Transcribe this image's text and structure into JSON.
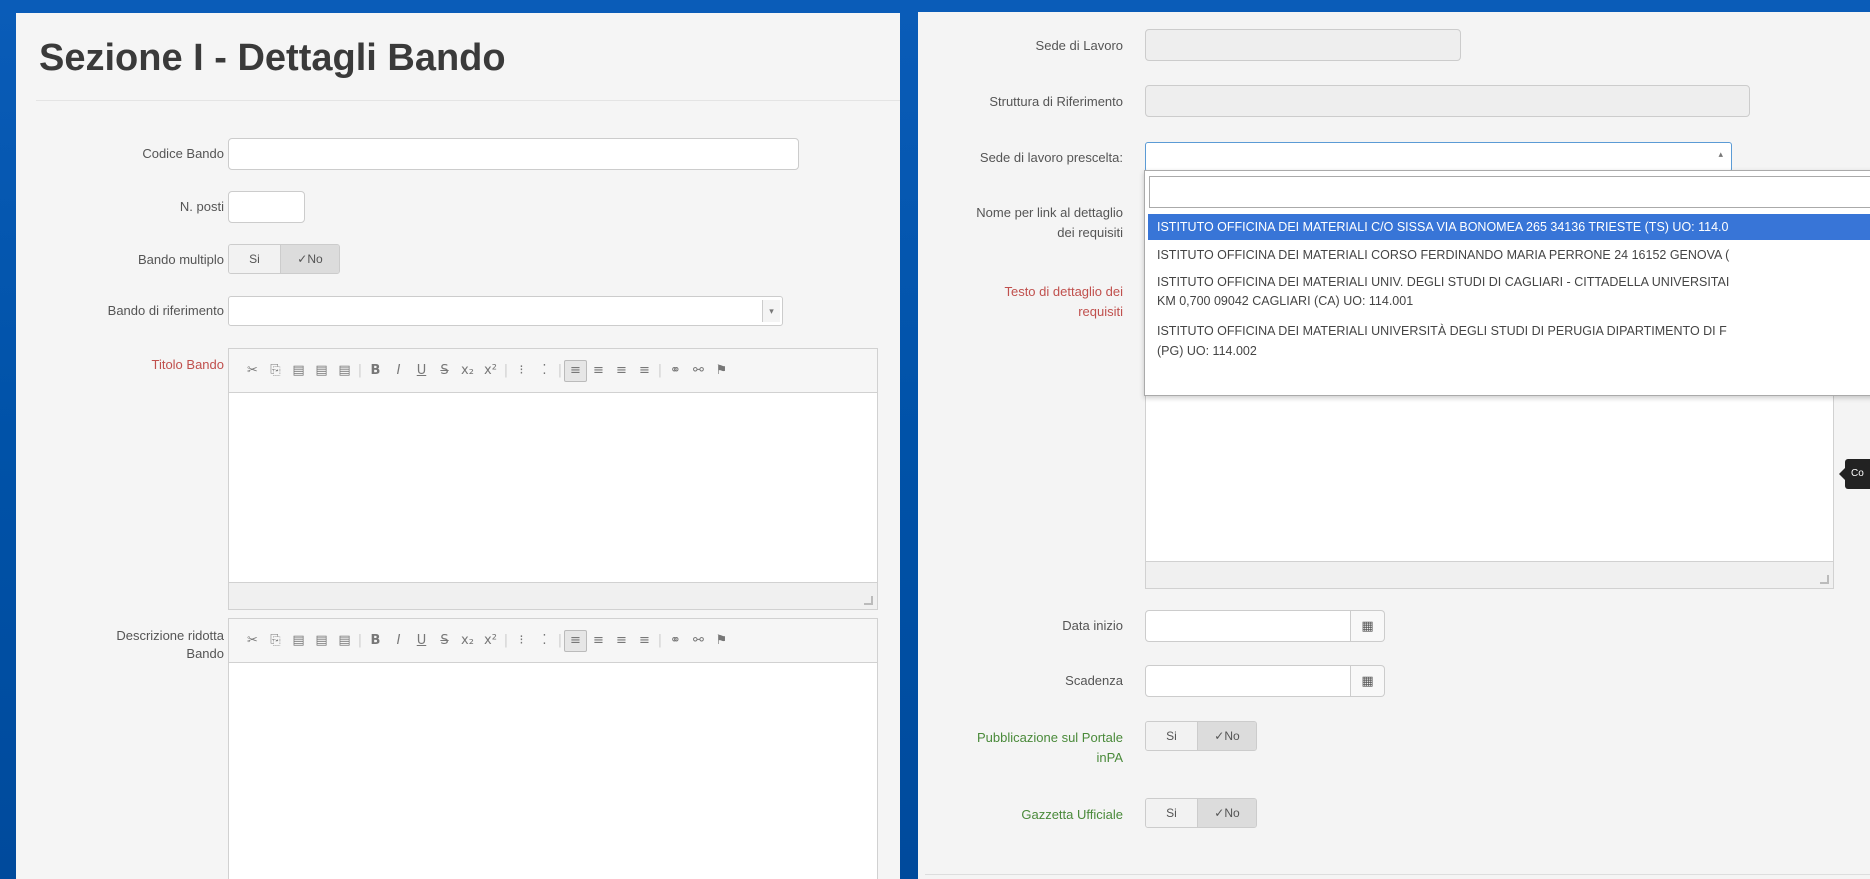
{
  "left": {
    "title": "Sezione I - Dettagli Bando",
    "fields": {
      "codice_bando": "Codice Bando",
      "n_posti": "N. posti",
      "bando_multiplo": "Bando multiplo",
      "bando_riferimento": "Bando di riferimento",
      "titolo_bando": "Titolo Bando",
      "descrizione_line1": "Descrizione ridotta",
      "descrizione_line2": "Bando"
    },
    "toggle_multiplo": {
      "si": "Si",
      "no": "✓No"
    }
  },
  "editor_toolbar": [
    "✕",
    "⎘",
    "▤",
    "▤",
    "▤",
    "|",
    "B",
    "I",
    "U",
    "S",
    "x₂",
    "x²",
    "|",
    "⁝",
    "⁚",
    "|",
    "≡",
    "≡",
    "≡",
    "≡",
    "|",
    "⚭",
    "⚯",
    "⚑"
  ],
  "right": {
    "fields": {
      "sede_lavoro": "Sede di Lavoro",
      "struttura": "Struttura di Riferimento",
      "sede_prescelta": "Sede di lavoro prescelta:",
      "nome_link_1": "Nome per link al dettaglio",
      "nome_link_2": "dei requisiti",
      "testo_dettaglio_1": "Testo di dettaglio dei",
      "testo_dettaglio_2": "requisiti",
      "data_inizio": "Data inizio",
      "scadenza": "Scadenza",
      "pubblicazione_1": "Pubblicazione sul Portale",
      "pubblicazione_2": "inPA",
      "gazzetta": "Gazzetta Ufficiale"
    },
    "toggle_pubblicazione": {
      "si": "Si",
      "no": "✓No"
    },
    "toggle_gazzetta": {
      "si": "Si",
      "no": "✓No"
    },
    "dropdown_options": [
      "ISTITUTO OFFICINA DEI MATERIALI C/O SISSA VIA BONOMEA 265 34136 TRIESTE (TS) UO: 114.0",
      "ISTITUTO OFFICINA DEI MATERIALI CORSO FERDINANDO MARIA PERRONE 24 16152 GENOVA (",
      "ISTITUTO OFFICINA DEI MATERIALI UNIV. DEGLI STUDI DI CAGLIARI - CITTADELLA UNIVERSITAI",
      "KM 0,700 09042 CAGLIARI (CA) UO: 114.001",
      "ISTITUTO OFFICINA DEI MATERIALI UNIVERSITÀ DEGLI STUDI DI PERUGIA DIPARTIMENTO DI F",
      "(PG) UO: 114.002"
    ],
    "tooltip": "Co"
  },
  "icons": {
    "calendar": "calendar-icon",
    "arrow": "chevron-up-icon"
  }
}
